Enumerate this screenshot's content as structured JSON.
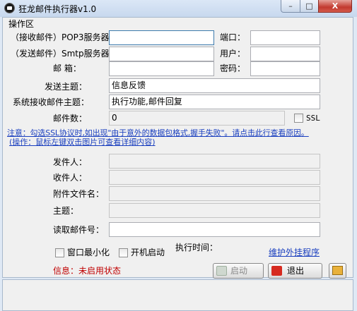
{
  "window": {
    "title": "狂龙邮件执行器v1.0",
    "min": "–",
    "max": "□",
    "close": "X"
  },
  "group_title": "操作区",
  "fields": {
    "pop3_label": "（接收邮件）POP3服务器：",
    "smtp_label": "（发送邮件）Smtp服务器：",
    "email_label": "邮  箱：",
    "port_label": "端口：",
    "user_label": "用户：",
    "password_label": "密码：",
    "send_subject_label": "发送主题：",
    "send_subject_value": "信息反馈",
    "sys_subject_label": "系统接收邮件主题：",
    "sys_subject_value": "执行功能,邮件回复",
    "mail_count_label": "邮件数：",
    "mail_count_value": "0",
    "ssl_label": "SSL"
  },
  "notice": {
    "line1": "注意：勾选SSL协议时,如出现\"由于意外的数据包格式,握手失败\"。请点击此行查看原因。",
    "line2": "(操作：鼠标左键双击图片可查看详细内容)"
  },
  "detail": {
    "sender_label": "发件人：",
    "recipient_label": "收件人：",
    "attachment_label": "附件文件名：",
    "subject_label": "主题：",
    "read_mail_label": "读取邮件号："
  },
  "options": {
    "minimize_label": "窗口最小化",
    "autostart_label": "开机启动",
    "exec_time_label": "执行时间：",
    "maintain_link": "维护外挂程序"
  },
  "status": {
    "text": "信息：未启用状态"
  },
  "buttons": {
    "start": "启动",
    "exit": "退出"
  },
  "colors": {
    "link": "#1a3fbf",
    "status": "#c00000",
    "exit_icon": "#d62a1f",
    "start_icon": "#5ca84a"
  }
}
